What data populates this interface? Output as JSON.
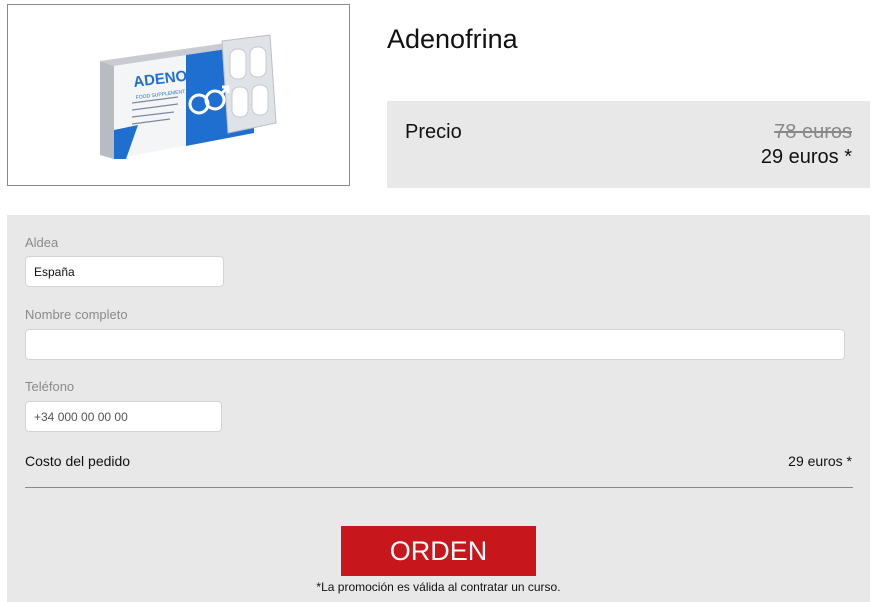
{
  "product": {
    "title": "Adenofrina",
    "image_brand": "ADENOFRIN",
    "image_subtitle": "FOOD SUPPLEMENT"
  },
  "price": {
    "label": "Precio",
    "old": "78 euros",
    "new": "29 euros *"
  },
  "form": {
    "country_label": "Aldea",
    "country_value": "España",
    "name_label": "Nombre completo",
    "name_value": "",
    "phone_label": "Teléfono",
    "phone_placeholder": "+34 000 00 00 00",
    "summary_label": "Costo del pedido",
    "summary_value": "29 euros *",
    "order_button": "ORDEN",
    "promo_note": "*La promoción es válida al contratar un curso."
  },
  "colors": {
    "accent_red": "#c8161d",
    "panel_gray": "#e8e8e8",
    "brand_blue": "#1f6fd1"
  }
}
